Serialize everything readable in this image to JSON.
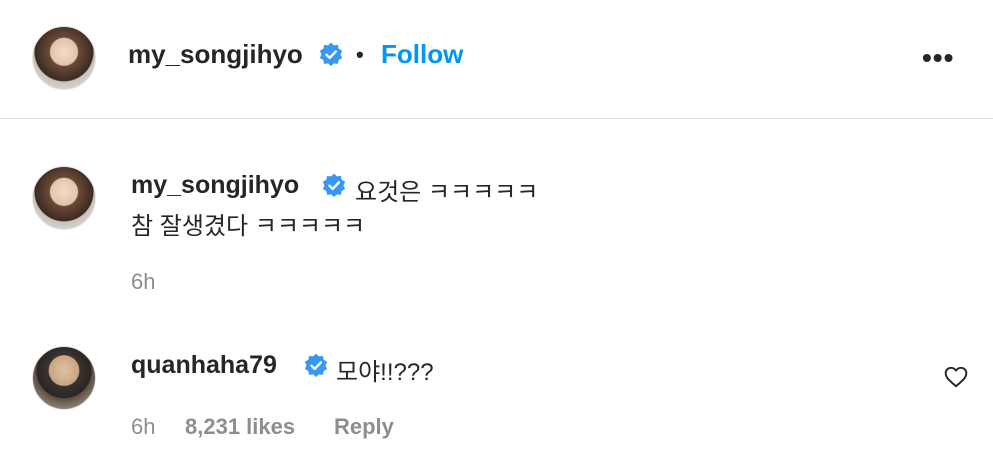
{
  "post_header": {
    "username": "my_songjihyo",
    "separator": "•",
    "follow_label": "Follow",
    "more_label": "•••"
  },
  "comments": [
    {
      "username": "my_songjihyo",
      "text_line1": "요것은 ㅋㅋㅋㅋㅋ",
      "text_line2": "참 잘생겼다 ㅋㅋㅋㅋㅋ",
      "time": "6h"
    },
    {
      "username": "quanhaha79",
      "text": "모야!!???",
      "time": "6h",
      "likes": "8,231 likes",
      "reply_label": "Reply"
    }
  ],
  "colors": {
    "accent": "#0095f6",
    "verified": "#3897f0",
    "muted": "#8e8e8e"
  }
}
